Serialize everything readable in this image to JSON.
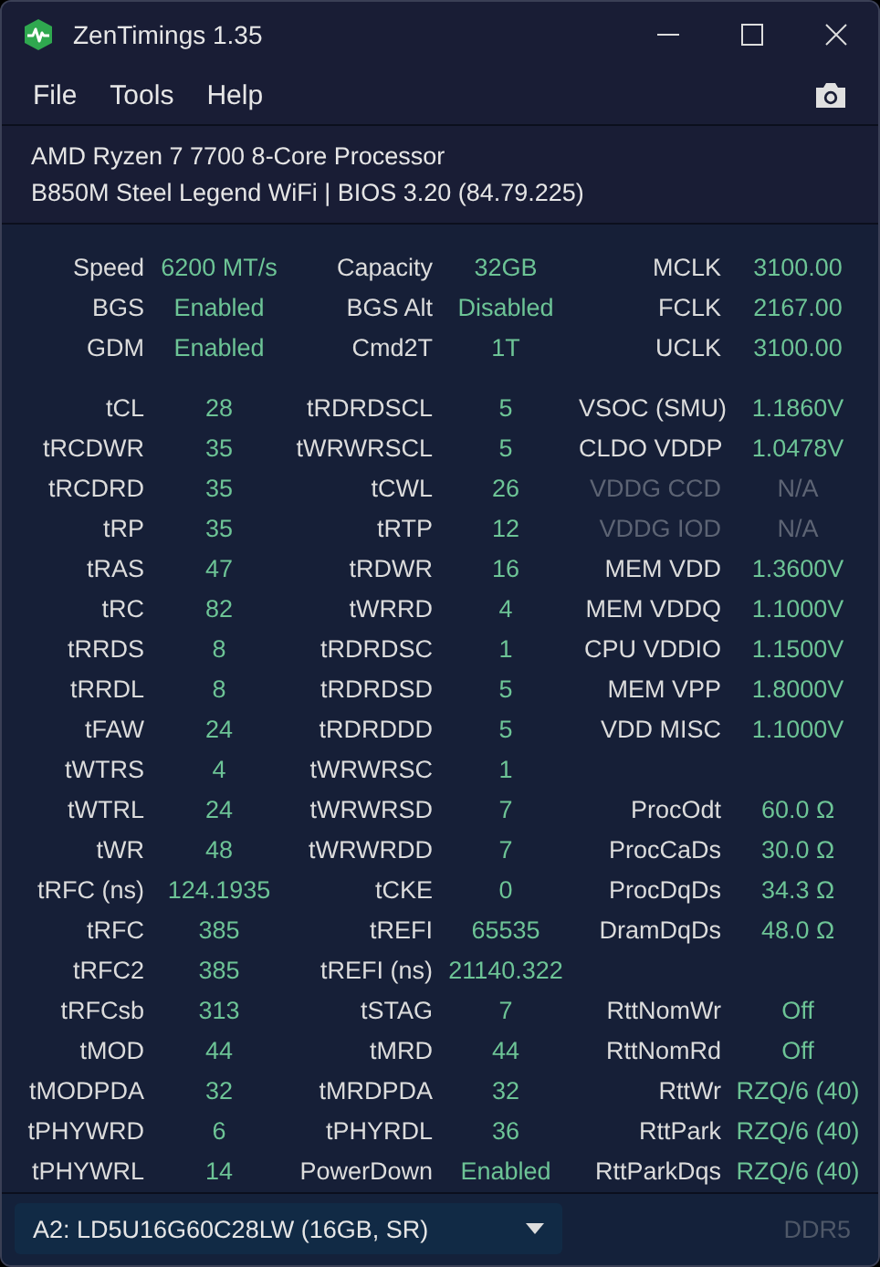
{
  "window": {
    "title": "ZenTimings 1.35"
  },
  "menu": [
    "File",
    "Tools",
    "Help"
  ],
  "system_info": [
    "AMD Ryzen 7 7700 8-Core Processor",
    "B850M Steel Legend WiFi | BIOS 3.20 (84.79.225)"
  ],
  "summary_rows": [
    [
      {
        "label": "Speed",
        "value": "6200 MT/s",
        "disabled": false
      },
      {
        "label": "Capacity",
        "value": "32GB",
        "disabled": false
      },
      {
        "label": "MCLK",
        "value": "3100.00",
        "disabled": false
      }
    ],
    [
      {
        "label": "BGS",
        "value": "Enabled",
        "disabled": false
      },
      {
        "label": "BGS Alt",
        "value": "Disabled",
        "disabled": false
      },
      {
        "label": "FCLK",
        "value": "2167.00",
        "disabled": false
      }
    ],
    [
      {
        "label": "GDM",
        "value": "Enabled",
        "disabled": false
      },
      {
        "label": "Cmd2T",
        "value": "1T",
        "disabled": false
      },
      {
        "label": "UCLK",
        "value": "3100.00",
        "disabled": false
      }
    ]
  ],
  "timing_rows": [
    [
      {
        "label": "tCL",
        "value": "28",
        "disabled": false
      },
      {
        "label": "tRDRDSCL",
        "value": "5",
        "disabled": false
      },
      {
        "label": "VSOC (SMU)",
        "value": "1.1860V",
        "disabled": false
      }
    ],
    [
      {
        "label": "tRCDWR",
        "value": "35",
        "disabled": false
      },
      {
        "label": "tWRWRSCL",
        "value": "5",
        "disabled": false
      },
      {
        "label": "CLDO VDDP",
        "value": "1.0478V",
        "disabled": false
      }
    ],
    [
      {
        "label": "tRCDRD",
        "value": "35",
        "disabled": false
      },
      {
        "label": "tCWL",
        "value": "26",
        "disabled": false
      },
      {
        "label": "VDDG CCD",
        "value": "N/A",
        "disabled": true
      }
    ],
    [
      {
        "label": "tRP",
        "value": "35",
        "disabled": false
      },
      {
        "label": "tRTP",
        "value": "12",
        "disabled": false
      },
      {
        "label": "VDDG IOD",
        "value": "N/A",
        "disabled": true
      }
    ],
    [
      {
        "label": "tRAS",
        "value": "47",
        "disabled": false
      },
      {
        "label": "tRDWR",
        "value": "16",
        "disabled": false
      },
      {
        "label": "MEM VDD",
        "value": "1.3600V",
        "disabled": false
      }
    ],
    [
      {
        "label": "tRC",
        "value": "82",
        "disabled": false
      },
      {
        "label": "tWRRD",
        "value": "4",
        "disabled": false
      },
      {
        "label": "MEM VDDQ",
        "value": "1.1000V",
        "disabled": false
      }
    ],
    [
      {
        "label": "tRRDS",
        "value": "8",
        "disabled": false
      },
      {
        "label": "tRDRDSC",
        "value": "1",
        "disabled": false
      },
      {
        "label": "CPU VDDIO",
        "value": "1.1500V",
        "disabled": false
      }
    ],
    [
      {
        "label": "tRRDL",
        "value": "8",
        "disabled": false
      },
      {
        "label": "tRDRDSD",
        "value": "5",
        "disabled": false
      },
      {
        "label": "MEM VPP",
        "value": "1.8000V",
        "disabled": false
      }
    ],
    [
      {
        "label": "tFAW",
        "value": "24",
        "disabled": false
      },
      {
        "label": "tRDRDDD",
        "value": "5",
        "disabled": false
      },
      {
        "label": "VDD MISC",
        "value": "1.1000V",
        "disabled": false
      }
    ],
    [
      {
        "label": "tWTRS",
        "value": "4",
        "disabled": false
      },
      {
        "label": "tWRWRSC",
        "value": "1",
        "disabled": false
      },
      null
    ],
    [
      {
        "label": "tWTRL",
        "value": "24",
        "disabled": false
      },
      {
        "label": "tWRWRSD",
        "value": "7",
        "disabled": false
      },
      {
        "label": "ProcOdt",
        "value": "60.0 Ω",
        "disabled": false
      }
    ],
    [
      {
        "label": "tWR",
        "value": "48",
        "disabled": false
      },
      {
        "label": "tWRWRDD",
        "value": "7",
        "disabled": false
      },
      {
        "label": "ProcCaDs",
        "value": "30.0 Ω",
        "disabled": false
      }
    ],
    [
      {
        "label": "tRFC (ns)",
        "value": "124.1935",
        "disabled": false
      },
      {
        "label": "tCKE",
        "value": "0",
        "disabled": false
      },
      {
        "label": "ProcDqDs",
        "value": "34.3 Ω",
        "disabled": false
      }
    ],
    [
      {
        "label": "tRFC",
        "value": "385",
        "disabled": false
      },
      {
        "label": "tREFI",
        "value": "65535",
        "disabled": false
      },
      {
        "label": "DramDqDs",
        "value": "48.0 Ω",
        "disabled": false
      }
    ],
    [
      {
        "label": "tRFC2",
        "value": "385",
        "disabled": false
      },
      {
        "label": "tREFI (ns)",
        "value": "21140.322",
        "disabled": false
      },
      null
    ],
    [
      {
        "label": "tRFCsb",
        "value": "313",
        "disabled": false
      },
      {
        "label": "tSTAG",
        "value": "7",
        "disabled": false
      },
      {
        "label": "RttNomWr",
        "value": "Off",
        "disabled": false
      }
    ],
    [
      {
        "label": "tMOD",
        "value": "44",
        "disabled": false
      },
      {
        "label": "tMRD",
        "value": "44",
        "disabled": false
      },
      {
        "label": "RttNomRd",
        "value": "Off",
        "disabled": false
      }
    ],
    [
      {
        "label": "tMODPDA",
        "value": "32",
        "disabled": false
      },
      {
        "label": "tMRDPDA",
        "value": "32",
        "disabled": false
      },
      {
        "label": "RttWr",
        "value": "RZQ/6 (40)",
        "disabled": false
      }
    ],
    [
      {
        "label": "tPHYWRD",
        "value": "6",
        "disabled": false
      },
      {
        "label": "tPHYRDL",
        "value": "36",
        "disabled": false
      },
      {
        "label": "RttPark",
        "value": "RZQ/6 (40)",
        "disabled": false
      }
    ],
    [
      {
        "label": "tPHYWRL",
        "value": "14",
        "disabled": false
      },
      {
        "label": "PowerDown",
        "value": "Enabled",
        "disabled": false
      },
      {
        "label": "RttParkDqs",
        "value": "RZQ/6 (40)",
        "disabled": false
      }
    ]
  ],
  "footer": {
    "module_select": "A2: LD5U16G60C28LW (16GB, SR)",
    "memory_type": "DDR5"
  }
}
